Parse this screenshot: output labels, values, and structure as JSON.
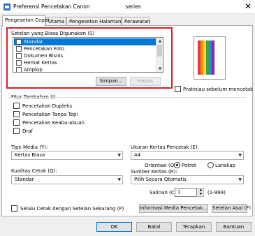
{
  "window": {
    "title": "Preferensi Pencetakan Canon",
    "title_suffix": "series",
    "close_glyph": "✕",
    "icon": "printer-icon"
  },
  "tabs": [
    {
      "label": "Pengesetan Cepat",
      "active": true
    },
    {
      "label": "Utama",
      "active": false
    },
    {
      "label": "Pengesetan Halaman",
      "active": false
    },
    {
      "label": "Perawatan",
      "active": false
    }
  ],
  "common_settings": {
    "label": "Setelan yang Biasa Digunakan (S)",
    "items": [
      {
        "label": "Standar",
        "selected": true
      },
      {
        "label": "Pencetakan Foto",
        "selected": false
      },
      {
        "label": "Dokumen Bisnis",
        "selected": false
      },
      {
        "label": "Hemat Kertas",
        "selected": false
      },
      {
        "label": "Amplop",
        "selected": false
      }
    ],
    "save_label": "Simpan...",
    "delete_label": "Hapus"
  },
  "preview": {
    "checkbox_label": "Pratinjau sebelum mencetak (W)",
    "checked": false
  },
  "additional": {
    "label": "Fitur Tambahan (I)",
    "options": [
      {
        "label": "Pencetakan Dupleks",
        "checked": false
      },
      {
        "label": "Pencetakan Tanpa Tepi",
        "checked": false
      },
      {
        "label": "Pencetakan Keabu-abuan",
        "checked": false
      },
      {
        "label": "Draf",
        "checked": false
      }
    ]
  },
  "media_type": {
    "label": "Tipe Media (Y):",
    "value": "Kertas Biasa"
  },
  "paper_size": {
    "label": "Ukuran Kertas Pencetak (E):",
    "value": "A4"
  },
  "orientation": {
    "label": "Orientasi (O):",
    "portrait": "Potret",
    "landscape": "Lanskap",
    "selected": "Potret"
  },
  "print_quality": {
    "label": "Kualitas Cetak (Q):",
    "value": "Standar"
  },
  "paper_source": {
    "label": "Sumber Kertas (R):",
    "value": "Pilih Secara Otomatis"
  },
  "copies": {
    "label": "Salinan (C):",
    "value": "1",
    "range": "(1-999)"
  },
  "always_print": {
    "label": "Selalu Cetak dengan Setelan Sekarang (P)",
    "checked": false
  },
  "buttons": {
    "media_info": "Informasi Media Pencetak...",
    "defaults": "Setelan Asal (F)",
    "ok": "OK",
    "cancel": "Batal",
    "apply": "Terapkan",
    "help": "Bantuan"
  },
  "colors": {
    "highlight": "#d81f26",
    "selection": "#0078d7"
  }
}
